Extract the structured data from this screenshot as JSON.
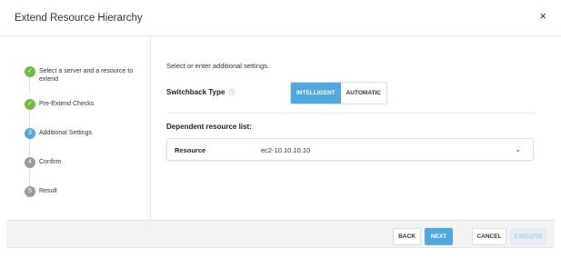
{
  "dialog": {
    "title": "Extend Resource Hierarchy",
    "close_glyph": "×"
  },
  "steps": [
    {
      "label": "Select a server and a resource to extend",
      "status": "done",
      "icon": "check-icon",
      "marker": "✓"
    },
    {
      "label": "Pre-Extend Checks",
      "status": "done",
      "icon": "check-icon",
      "marker": "✓"
    },
    {
      "label": "Additional Settings",
      "status": "current",
      "icon": "step-3-icon",
      "marker": "3"
    },
    {
      "label": "Confirm",
      "status": "pending",
      "icon": "step-4-icon",
      "marker": "4"
    },
    {
      "label": "Result",
      "status": "pending",
      "icon": "step-5-icon",
      "marker": "5"
    }
  ],
  "main": {
    "intro": "Select or enter additional settings.",
    "switchback": {
      "label": "Switchback Type",
      "info_glyph": "ⓘ",
      "options": [
        "INTELLIGENT",
        "AUTOMATIC"
      ],
      "selected": "INTELLIGENT"
    },
    "dependent_label": "Dependent resource list:",
    "resource": {
      "header": "Resource",
      "value": "ec2-10.10.10.10",
      "chevron": "⌄"
    }
  },
  "footer": {
    "back": "BACK",
    "next": "NEXT",
    "cancel": "CANCEL",
    "execute": "EXECUTE"
  },
  "colors": {
    "accent": "#4fa8e0",
    "success": "#6cbf3c",
    "pending": "#9a9a9a",
    "disabled_bg": "#e4edf6"
  }
}
